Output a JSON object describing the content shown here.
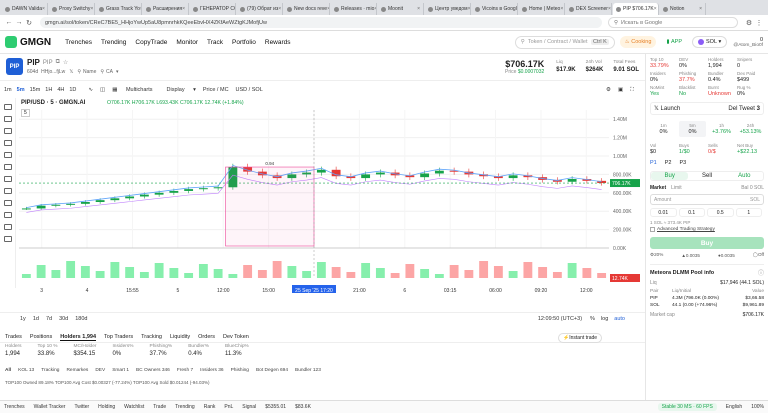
{
  "browser": {
    "tabs": [
      "DAWN Valida",
      "Proxy Switchy",
      "Grass Track Yo",
      "Расширения",
      "ГЕНЕРАТОР СС",
      "(79) Обрат из",
      "New docs reve",
      "Releases · mio",
      "Moonit",
      "Центр уведом",
      "Vicoins в Google",
      "Home | Meteo",
      "DEX Screener",
      "PIP $706.17K",
      "Notion"
    ],
    "active_tab": 13,
    "url": "gmgn.ai/sol/token/CReC7BE5_HHjoYwUp5aU8pmnrhkKQeeEbvHX4ZKfAeWZtgKJMofjUw",
    "search_placeholder": "Искать в Google"
  },
  "header": {
    "logo": "GMGN",
    "nav": [
      "Trenches",
      "Trending",
      "CopyTrade",
      "Monitor",
      "Track",
      "Portfolio",
      "Rewards"
    ],
    "search_placeholder": "Token / Contract / Wallet",
    "search_hint": "Ctrl K",
    "cooking": "Cooking",
    "app": "APP",
    "chain": "SOL",
    "balance": "0",
    "user": "@Atom_Bio0f"
  },
  "token": {
    "symbol": "PIP",
    "name": "PIP",
    "age": "604d",
    "address": "HHjo...fjLw",
    "name_hint": "Name",
    "ca_hint": "CA",
    "mcap": "$706.17K",
    "price_label": "Price",
    "price": "$0.0007032",
    "liq_label": "Liq",
    "liq": "$17.9K",
    "vol_label": "24h Vol",
    "vol": "$264K",
    "fees_label": "Total Fees",
    "fees": "9.01 SOL"
  },
  "chart_toolbar": {
    "intervals": [
      "1m",
      "5m",
      "15m",
      "1H",
      "4H",
      "1D"
    ],
    "active_interval": "5m",
    "multicharts": "Multicharts",
    "display": "Display",
    "price_mc": "Price / MC",
    "usd_sol": "USD / SOL"
  },
  "chart_legend": {
    "title": "PIP/USD · 5 · GMGN.AI",
    "ohlc": "O706.17K H706.17K L693.43K C706.17K 12.74K (+1.84%)",
    "indicator": "5"
  },
  "chart_data": {
    "type": "line",
    "title": "PIP/USD · 5 · GMGN.AI",
    "y_unit": "USD market cap",
    "ylim": [
      0,
      1500000
    ],
    "y_ticks": [
      "1.40M",
      "1.20M",
      "1.00M",
      "800.00K",
      "600.00K",
      "400.00K",
      "200.00K",
      "0.00K"
    ],
    "x_ticks": [
      "3",
      "4",
      "15:55",
      "5",
      "12:00",
      "15:00",
      "25 Sep '25  17:20",
      "21:00",
      "6",
      "03:15",
      "06:00",
      "09:20",
      "12:00"
    ],
    "last_price_label": "706.17K",
    "volume_label": "12.74K",
    "annotation": "0.94",
    "series": [
      {
        "values": [
          430000,
          460000,
          470000,
          480000,
          500000,
          520000,
          540000,
          560000,
          580000,
          600000,
          620000,
          640000,
          650000,
          660000,
          880000,
          830000,
          790000,
          760000,
          800000,
          820000,
          850000,
          780000,
          760000,
          800000,
          820000,
          790000,
          770000,
          810000,
          840000,
          830000,
          800000,
          780000,
          760000,
          790000,
          770000,
          740000,
          720000,
          750000,
          730000,
          706170
        ]
      }
    ],
    "grid": true
  },
  "range_bar": {
    "ranges": [
      "1y",
      "1d",
      "7d",
      "30d",
      "180d"
    ],
    "time": "12:09:50 (UTC+3)",
    "percent": "%",
    "log": "log",
    "auto": "auto"
  },
  "bottom_tabs": [
    "Trades",
    "Positions",
    "Holders 1,994",
    "Top Traders",
    "Tracking",
    "Liquidity",
    "Orders",
    "Dev Token"
  ],
  "instant_trade": "Instant trade",
  "stats": [
    {
      "label": "Holders",
      "value": "1,994"
    },
    {
      "label": "Top 10 %",
      "value": "33.8%"
    },
    {
      "label": "MC/Holder",
      "value": "$354.15"
    },
    {
      "label": "Insiders%",
      "value": "0%"
    },
    {
      "label": "Phishing%",
      "value": "37.7%"
    },
    {
      "label": "Bundler%",
      "value": "0.4%"
    },
    {
      "label": "BlueChip%",
      "value": "11.3%"
    }
  ],
  "filters": [
    "All",
    "KOL 13",
    "Tracking",
    "Remarkes",
    "DEV",
    "Smart 1",
    "BC Owners 346",
    "Fresh 7",
    "Insiders 36",
    "Phishing",
    "Bot Degen 694",
    "Bundler 123"
  ],
  "holders_line": "TOP100 Owned 89.18%   TOP100 Avg Cost $0.00327 (-77.24%)   TOP100 Avg Sold $0.01244 (-94.03%)",
  "right": {
    "metrics": [
      {
        "label": "Top 10",
        "value": "33.79%",
        "color": "#e53935"
      },
      {
        "label": "DEV",
        "value": "0%",
        "color": "#222222"
      },
      {
        "label": "Holders",
        "value": "1,994",
        "color": "#222222"
      },
      {
        "label": "Snipers",
        "value": "0",
        "color": "#222222"
      },
      {
        "label": "Insiders",
        "value": "0%",
        "color": "#222222"
      },
      {
        "label": "Phishing",
        "value": "37.7%",
        "color": "#e53935"
      },
      {
        "label": "Bundler",
        "value": "0.4%",
        "color": "#222222"
      },
      {
        "label": "Dex Paid",
        "value": "$499",
        "color": "#222222"
      },
      {
        "label": "NoMint",
        "value": "Yes",
        "color": "#16a34a"
      },
      {
        "label": "Blacklist",
        "value": "No",
        "color": "#16a34a"
      },
      {
        "label": "Burnt",
        "value": "Unknown",
        "color": "#e53935"
      },
      {
        "label": "Rug %",
        "value": "0%",
        "color": "#222222"
      }
    ],
    "launch": "Launch",
    "dev_tweet": "Del Tweet",
    "dev_tweet_count": "3",
    "periods": [
      {
        "label": "1m",
        "value": "0%"
      },
      {
        "label": "5m",
        "value": "0%"
      },
      {
        "label": "1h",
        "value": "+3.76%"
      },
      {
        "label": "24h",
        "value": "+53.13%"
      }
    ],
    "trades": [
      {
        "label": "Vol",
        "value": "$0"
      },
      {
        "label": "Buys",
        "value": "1/$0"
      },
      {
        "label": "Sells",
        "value": "0/$"
      },
      {
        "label": "Net Buy",
        "value": "+$22.13"
      }
    ],
    "presets": [
      "P1",
      "P2",
      "P3"
    ],
    "buy": "Buy",
    "sell": "Sell",
    "auto": "Auto",
    "market": "Market",
    "limit": "Limit",
    "bal": "Bal 0 SOL",
    "amount": "Amount",
    "unit": "SOL",
    "amounts": [
      "0.01",
      "0.1",
      "0.5",
      "1"
    ],
    "rate": "1 SOL ≈ 373.4K PIP",
    "adv": "Advanced Trading Strategy",
    "buy_btn": "Buy",
    "slippage": "20%",
    "prio": "0.0035",
    "tip": "0.0035",
    "off": "Off",
    "pool": "Meteora DLMM Pool info",
    "pool_liq_label": "Liq",
    "pool_liq": "$17,946 (44.1 SOL)",
    "pair_label": "Pair",
    "liq_init_label": "Liq/Initial",
    "value_label": "Value",
    "pool_rows": [
      {
        "t": "PIP",
        "a": "4.3M (796.0K (0.00%)",
        "v": "$3,66.58"
      },
      {
        "t": "SOL",
        "a": "44.1 (0.00 (+74.96%)",
        "v": "$9,961.89"
      }
    ],
    "mcap_label": "Market cap",
    "mcap": "$706.17K"
  },
  "footer": [
    "Trenches",
    "Wallet Tracker",
    "Twitter",
    "Holding",
    "Watchlist",
    "Trade",
    "Trending",
    "Rank",
    "PnL",
    "Signal",
    "$5355.01",
    "$83.6K"
  ],
  "footer_right": "Stable 30 MS · 60 FPS",
  "footer_lang": "English",
  "zoom": "100%"
}
